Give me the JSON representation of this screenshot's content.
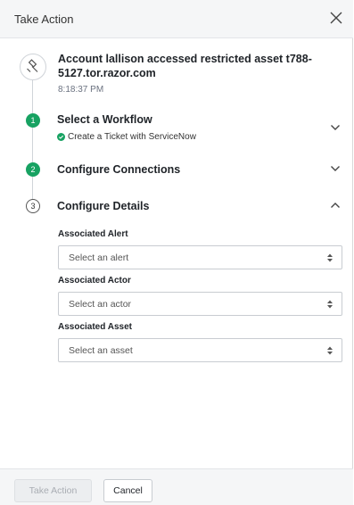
{
  "dialog": {
    "title": "Take Action"
  },
  "alert": {
    "icon": "gavel-icon",
    "title": "Account lallison accessed restricted asset t788-5127.tor.razor.com",
    "time": "8:18:37 PM"
  },
  "steps": [
    {
      "number": "1",
      "status": "complete",
      "title": "Select a Workflow",
      "summary": "Create a Ticket with ServiceNow",
      "expanded": false
    },
    {
      "number": "2",
      "status": "complete",
      "title": "Configure Connections",
      "expanded": false
    },
    {
      "number": "3",
      "status": "current",
      "title": "Configure Details",
      "expanded": true
    }
  ],
  "details": {
    "fields": [
      {
        "label": "Associated Alert",
        "placeholder": "Select an alert"
      },
      {
        "label": "Associated Actor",
        "placeholder": "Select an actor"
      },
      {
        "label": "Associated Asset",
        "placeholder": "Select an asset"
      }
    ]
  },
  "footer": {
    "primary_label": "Take Action",
    "primary_disabled": true,
    "cancel_label": "Cancel"
  },
  "colors": {
    "accent_green": "#17a262",
    "header_bg": "#f5f6f7"
  }
}
